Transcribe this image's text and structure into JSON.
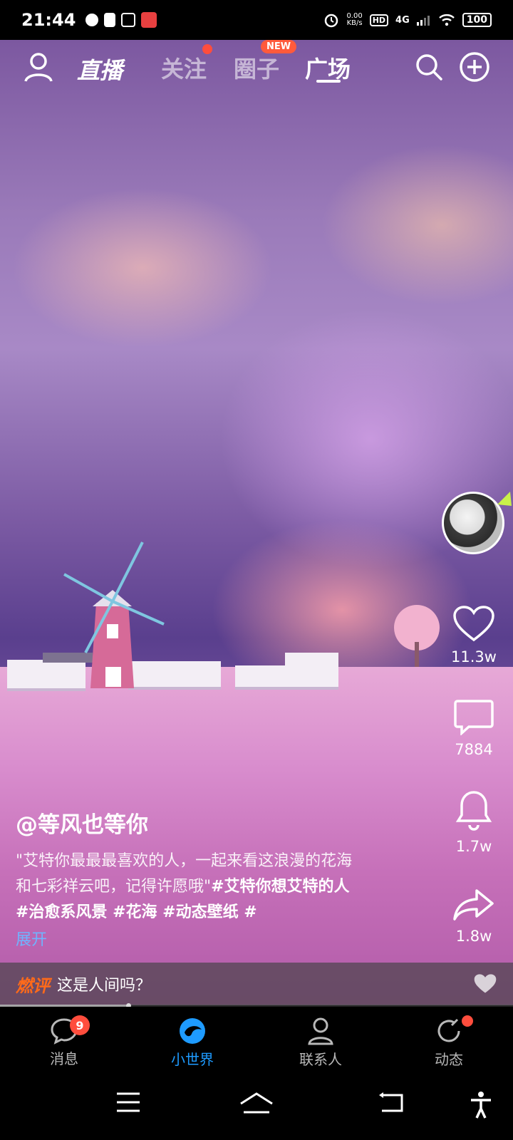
{
  "status_bar": {
    "time": "21:44",
    "net_speed_value": "0.00",
    "net_speed_unit": "KB/s",
    "hd_label": "HD",
    "network": "4G",
    "battery": "100"
  },
  "top_nav": {
    "logo_text": "直播",
    "tabs": [
      {
        "label": "关注",
        "has_dot": true
      },
      {
        "label": "圈子",
        "badge": "NEW"
      },
      {
        "label": "广场",
        "active": true
      }
    ]
  },
  "post": {
    "author": "@等风也等你",
    "description": "\"艾特你最最最喜欢的人，一起来看这浪漫的花海和七彩祥云吧，记得许愿哦\"",
    "tags_text": "#艾特你想艾特的人 #治愈系风景 #花海 #动态壁纸 #",
    "expand_label": "展开",
    "likes": "11.3w",
    "comments": "7884",
    "reminders": "1.7w",
    "shares": "1.8w",
    "playback_progress": 0.25
  },
  "hot_comment": {
    "label": "燃评",
    "text": "这是人间吗？"
  },
  "bottom_tabs": [
    {
      "label": "消息",
      "badge": "9"
    },
    {
      "label": "小世界",
      "active": true
    },
    {
      "label": "联系人"
    },
    {
      "label": "动态",
      "has_dot": true
    }
  ],
  "colors": {
    "accent_blue": "#1e9bff",
    "badge_red": "#ff4d3d",
    "hot_orange": "#ff6a1a",
    "link_blue": "#6fb4ff"
  }
}
